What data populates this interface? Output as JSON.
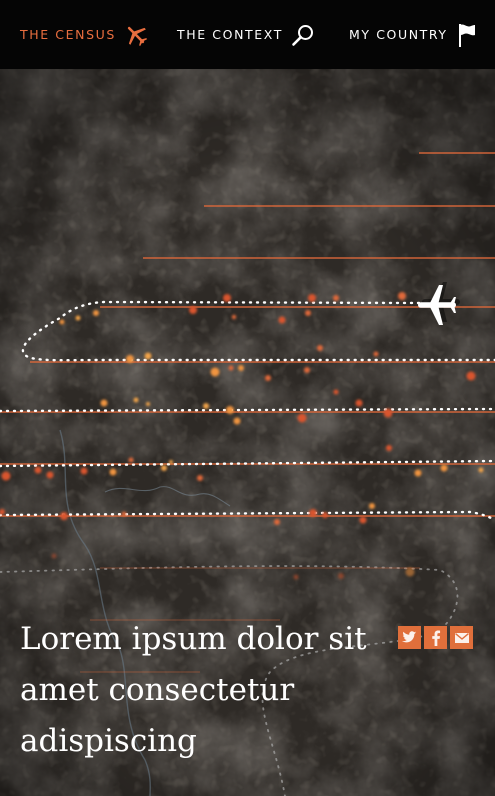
{
  "nav": {
    "items": [
      {
        "label": "THE CENSUS",
        "icon": "airplane-icon",
        "active": true
      },
      {
        "label": "THE CONTEXT",
        "icon": "magnifier-icon",
        "active": false
      },
      {
        "label": "MY COUNTRY",
        "icon": "flag-icon",
        "active": false
      }
    ]
  },
  "hero": {
    "headline": "Lorem ipsum dolor sit amet consectetur adispiscing"
  },
  "share": [
    {
      "icon": "twitter-icon"
    },
    {
      "icon": "facebook-icon"
    },
    {
      "icon": "email-icon"
    }
  ],
  "colors": {
    "accent": "#e96e3f",
    "nav_bg": "#050505",
    "terrain": "#2c2824"
  }
}
